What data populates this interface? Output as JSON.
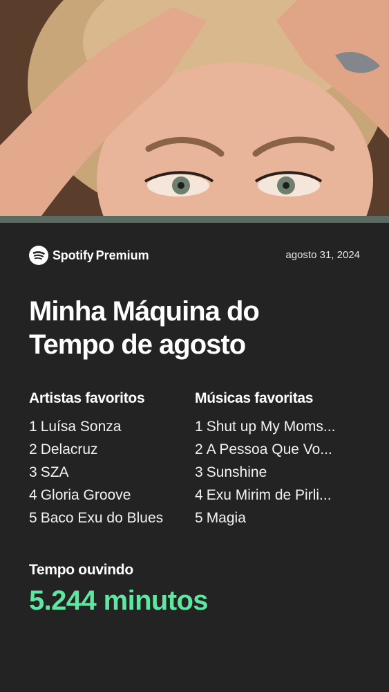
{
  "brand": {
    "name": "Spotify",
    "tier": "Premium",
    "icon": "spotify-logo-icon"
  },
  "date": "agosto 31, 2024",
  "title_line1": "Minha Máquina do",
  "title_line2": "Tempo de agosto",
  "artists": {
    "heading": "Artistas favoritos",
    "items": [
      {
        "rank": "1",
        "name": "Luísa Sonza"
      },
      {
        "rank": "2",
        "name": "Delacruz"
      },
      {
        "rank": "3",
        "name": "SZA"
      },
      {
        "rank": "4",
        "name": "Gloria Groove"
      },
      {
        "rank": "5",
        "name": "Baco Exu do Blues"
      }
    ]
  },
  "songs": {
    "heading": "Músicas favoritas",
    "items": [
      {
        "rank": "1",
        "name": "Shut up My Moms..."
      },
      {
        "rank": "2",
        "name": "A Pessoa Que Vo..."
      },
      {
        "rank": "3",
        "name": "Sunshine"
      },
      {
        "rank": "4",
        "name": "Exu Mirim de Pirli..."
      },
      {
        "rank": "5",
        "name": "Magia"
      }
    ]
  },
  "listening": {
    "label": "Tempo ouvindo",
    "value": "5.244 minutos"
  },
  "colors": {
    "background": "#232323",
    "accent_green": "#5ee7a0",
    "text": "#ffffff"
  }
}
